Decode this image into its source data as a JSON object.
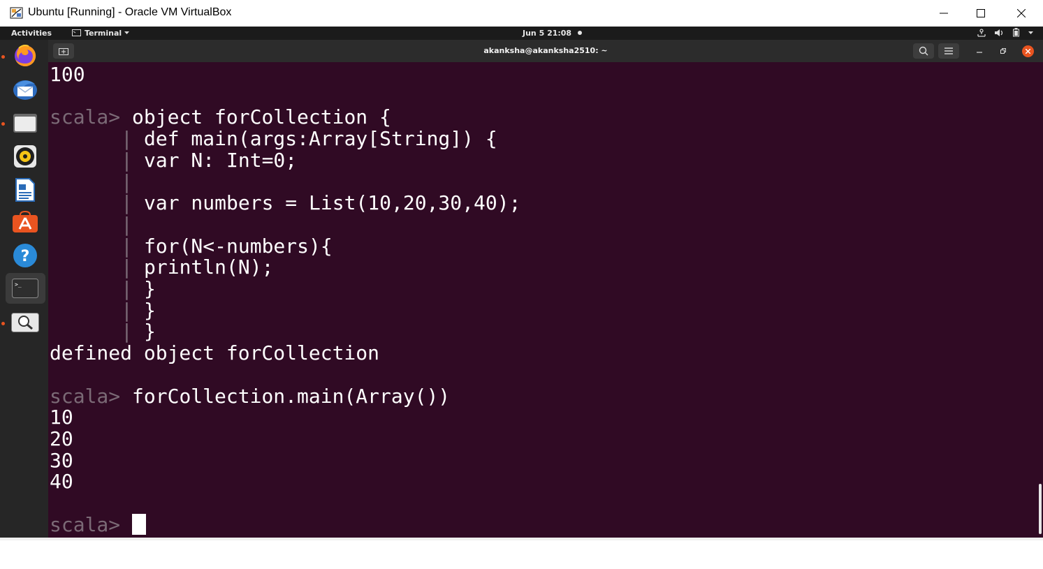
{
  "window": {
    "title": "Ubuntu [Running] - Oracle VM VirtualBox"
  },
  "topbar": {
    "activities": "Activities",
    "app_menu": "Terminal",
    "clock": "Jun 5  21:08"
  },
  "dock": {
    "apps": [
      "firefox-icon",
      "thunderbird-icon",
      "files-icon",
      "rhythmbox-icon",
      "libreoffice-writer-icon",
      "software-center-icon",
      "help-icon",
      "terminal-icon",
      "screenshot-viewer-icon"
    ],
    "active_app": "terminal-icon"
  },
  "terminal": {
    "title": "akanksha@akanksha2510: ~",
    "lines": [
      {
        "kind": "output",
        "text": "100"
      },
      {
        "kind": "blank",
        "text": ""
      },
      {
        "kind": "prompt",
        "prompt": "scala>",
        "text": "object forCollection {"
      },
      {
        "kind": "cont",
        "text": "def main(args:Array[String]) {"
      },
      {
        "kind": "cont",
        "text": "var N: Int=0;"
      },
      {
        "kind": "cont",
        "text": ""
      },
      {
        "kind": "cont",
        "text": "var numbers = List(10,20,30,40);"
      },
      {
        "kind": "cont",
        "text": ""
      },
      {
        "kind": "cont",
        "text": "for(N<-numbers){"
      },
      {
        "kind": "cont",
        "text": "println(N);"
      },
      {
        "kind": "cont",
        "text": "}"
      },
      {
        "kind": "cont",
        "text": "}"
      },
      {
        "kind": "cont",
        "text": "}"
      },
      {
        "kind": "output",
        "text": "defined object forCollection"
      },
      {
        "kind": "blank",
        "text": ""
      },
      {
        "kind": "prompt",
        "prompt": "scala>",
        "text": "forCollection.main(Array())"
      },
      {
        "kind": "output",
        "text": "10"
      },
      {
        "kind": "output",
        "text": "20"
      },
      {
        "kind": "output",
        "text": "30"
      },
      {
        "kind": "output",
        "text": "40"
      },
      {
        "kind": "blank",
        "text": ""
      },
      {
        "kind": "prompt_cursor",
        "prompt": "scala>",
        "text": ""
      }
    ]
  },
  "colors": {
    "terminal_bg": "#300a24",
    "prompt": "#7b6a76",
    "accent": "#e95420"
  }
}
